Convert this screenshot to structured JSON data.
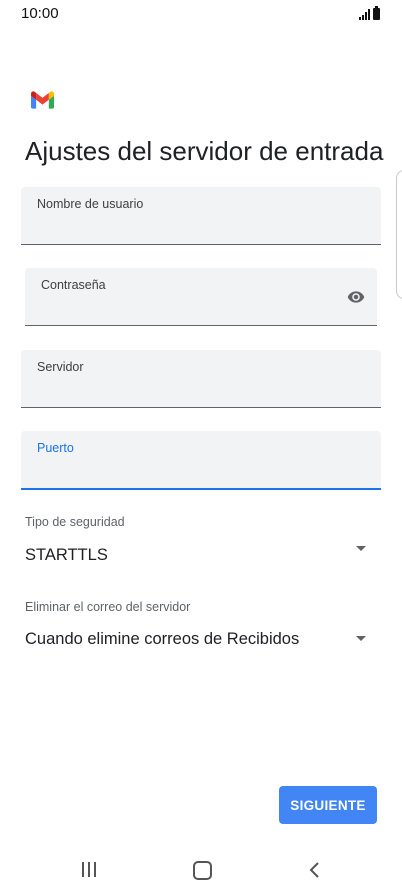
{
  "status_bar": {
    "time": "10:00"
  },
  "page_title": "Ajustes del servidor de entrada",
  "fields": {
    "username": {
      "label": "Nombre de usuario",
      "value": ""
    },
    "password": {
      "label": "Contraseña",
      "value": ""
    },
    "server": {
      "label": "Servidor",
      "value": ""
    },
    "port": {
      "label": "Puerto",
      "value": ""
    }
  },
  "security": {
    "label": "Tipo de seguridad",
    "value": "STARTTLS"
  },
  "delete_from_server": {
    "label": "Eliminar el correo del servidor",
    "value": "Cuando elimine correos de Recibidos"
  },
  "next_label": "SIGUIENTE",
  "colors": {
    "accent": "#1a73e8",
    "button": "#4285f4"
  },
  "icons": [
    "gmail-logo",
    "visibility-eye-icon",
    "dropdown-arrow-icon",
    "recents-icon",
    "home-icon",
    "back-icon"
  ]
}
